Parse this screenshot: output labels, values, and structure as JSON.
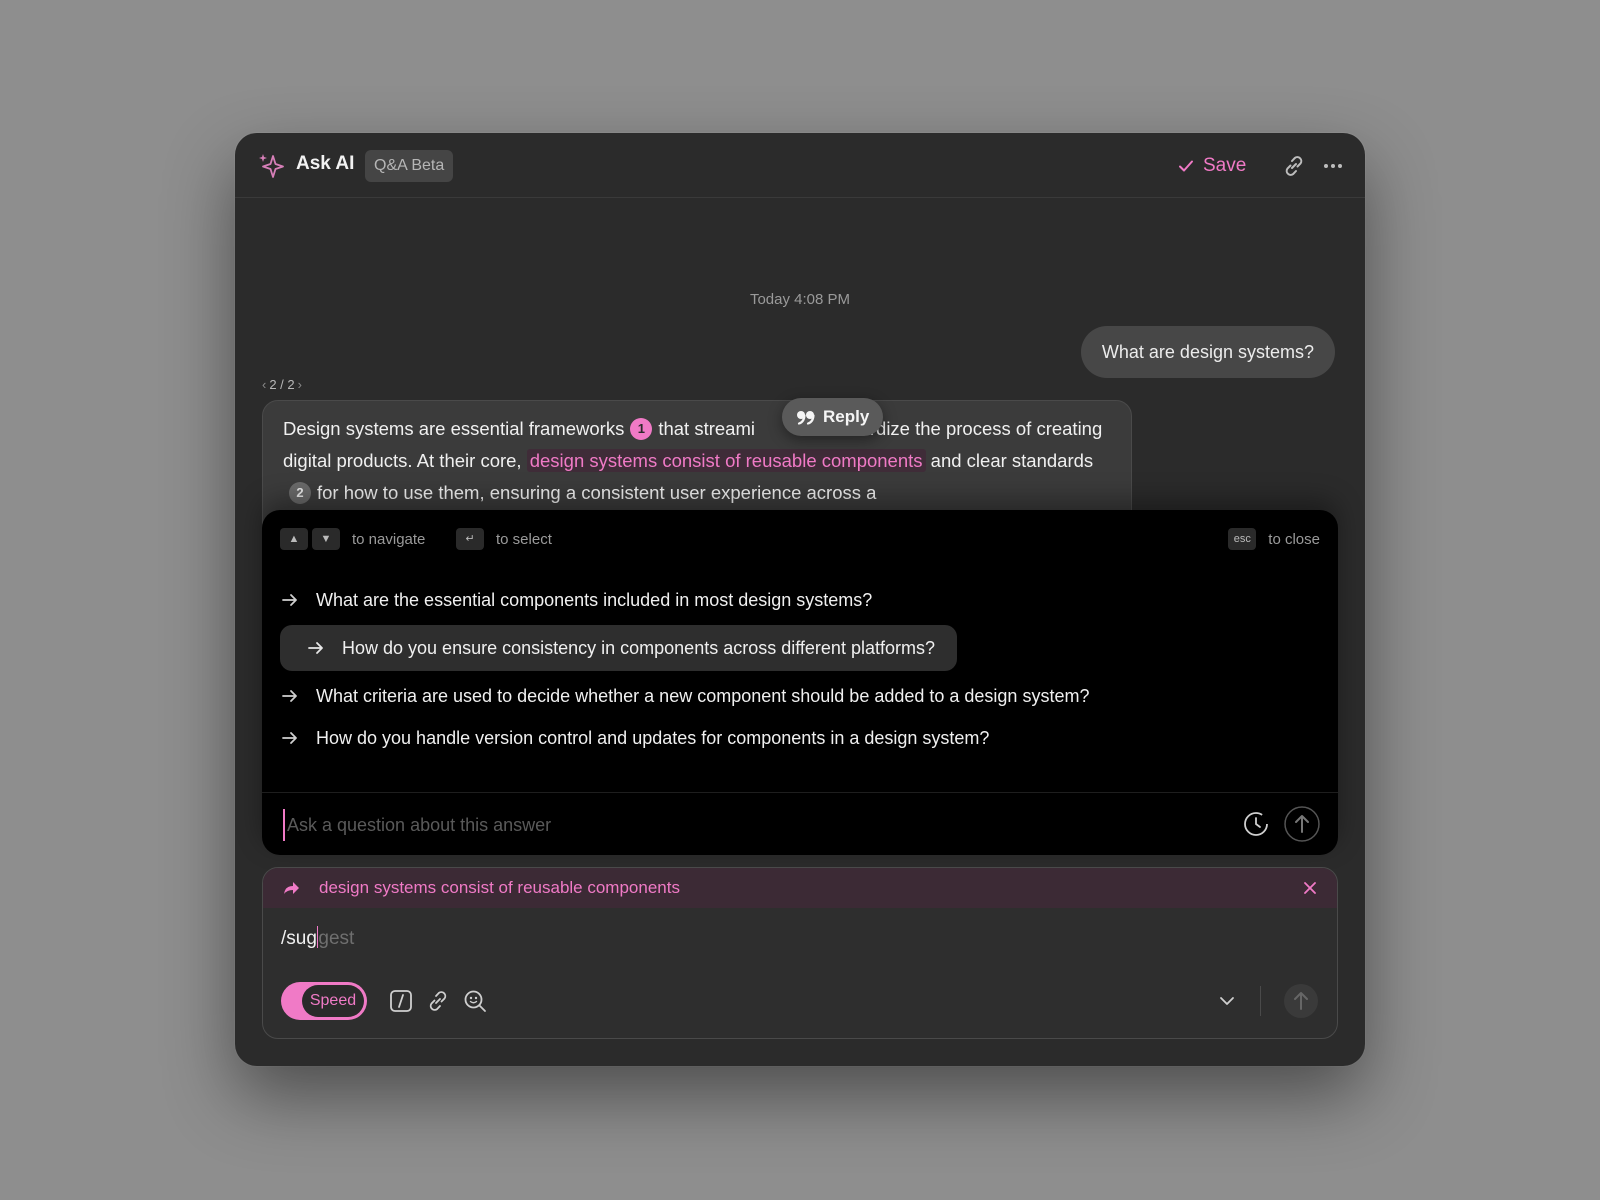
{
  "header": {
    "title": "Ask AI",
    "badge": "Q&A Beta",
    "save_label": "Save",
    "icons": [
      "sparkle-icon",
      "check-icon",
      "link-icon",
      "more-icon"
    ]
  },
  "chat": {
    "timestamp": "Today 4:08 PM",
    "user_message": "What are design systems?",
    "pager": "2 / 2",
    "answer": {
      "part1": "Design systems are essential frameworks",
      "cite1": "1",
      "part2": "that streami",
      "part3": "ndardize the process of creating digital products. At their core,",
      "highlight": "design systems consist of reusable components",
      "part4": "and clear standards",
      "cite2": "2",
      "part5": "for how to use them, ensuring a consistent user experience across a"
    },
    "reply_label": "Reply"
  },
  "suggest_panel": {
    "hint_navigate": "to navigate",
    "hint_select": "to select",
    "hint_close": "to close",
    "key_up": "▲",
    "key_down": "▼",
    "key_enter": "↵",
    "key_esc": "esc",
    "suggestions": [
      "What are the essential components included in most design systems?",
      "How do you ensure consistency in components across different platforms?",
      "What criteria are used to decide whether a new component should be added to a design system?",
      "How do you handle version control and updates for components in a design system?"
    ],
    "selected_index": 1,
    "input_placeholder": "Ask a question about this answer"
  },
  "composer": {
    "quote": "design systems consist of reusable components",
    "typed": "/sug",
    "ghost": "gest",
    "speed_label": "Speed"
  },
  "colors": {
    "accent": "#f07ac6",
    "window_bg": "#2b2b2b",
    "panel_bg": "#000000"
  }
}
